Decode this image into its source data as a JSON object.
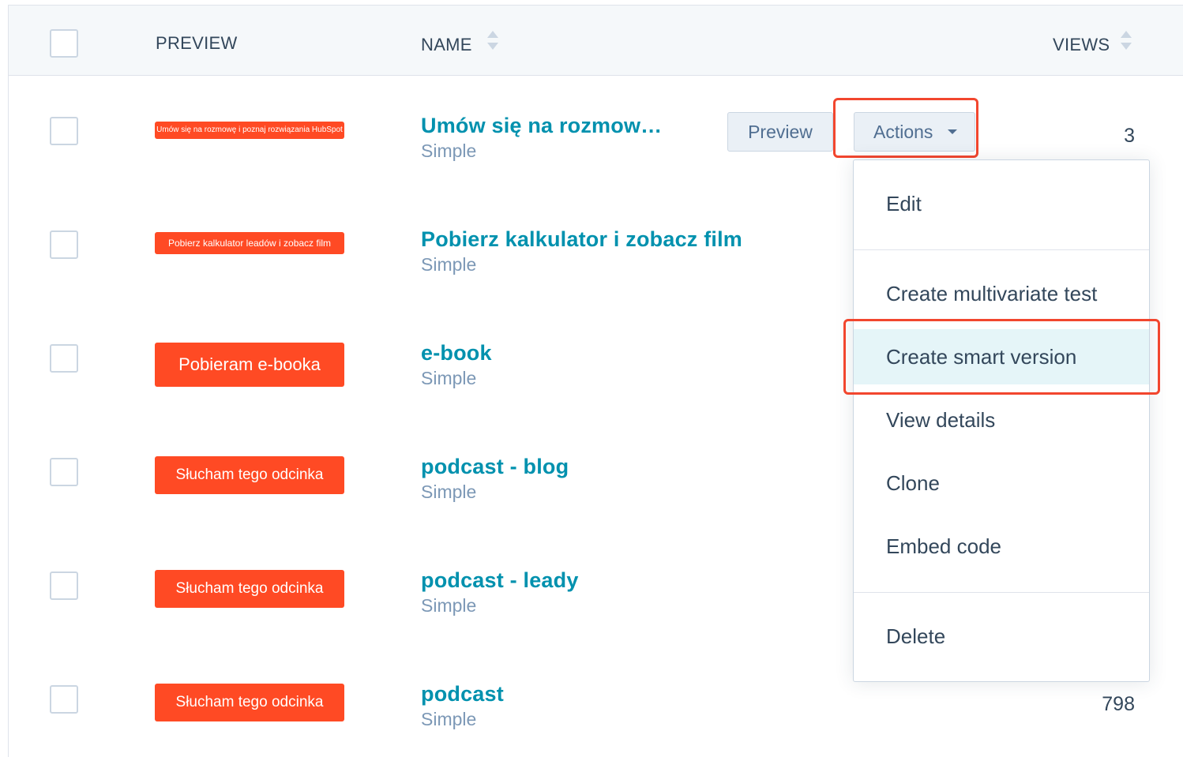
{
  "table": {
    "columns": {
      "preview": "PREVIEW",
      "name": "NAME",
      "views": "VIEWS"
    },
    "rows": [
      {
        "cta_text": "Umów się na rozmowę i poznaj rozwiązania HubSpot",
        "name": "Umów się na rozmow…",
        "type": "Simple",
        "views": "3"
      },
      {
        "cta_text": "Pobierz kalkulator leadów i zobacz film",
        "name": "Pobierz kalkulator i zobacz film",
        "type": "Simple",
        "views": ""
      },
      {
        "cta_text": "Pobieram e-booka",
        "name": "e-book",
        "type": "Simple",
        "views": ""
      },
      {
        "cta_text": "Słucham tego odcinka",
        "name": "podcast - blog",
        "type": "Simple",
        "views": ""
      },
      {
        "cta_text": "Słucham tego odcinka",
        "name": "podcast - leady",
        "type": "Simple",
        "views": ""
      },
      {
        "cta_text": "Słucham tego odcinka",
        "name": "podcast",
        "type": "Simple",
        "views": "798"
      }
    ]
  },
  "row_actions": {
    "preview_label": "Preview",
    "actions_label": "Actions"
  },
  "actions_menu": {
    "items": [
      "Edit",
      "Create multivariate test",
      "Create smart version",
      "View details",
      "Clone",
      "Embed code",
      "Delete"
    ],
    "active_item": "Create smart version"
  },
  "colors": {
    "link": "#0091ae",
    "cta_background": "#ff4a24",
    "highlight_border": "#f2462e",
    "active_item_background": "#e5f5f8"
  }
}
